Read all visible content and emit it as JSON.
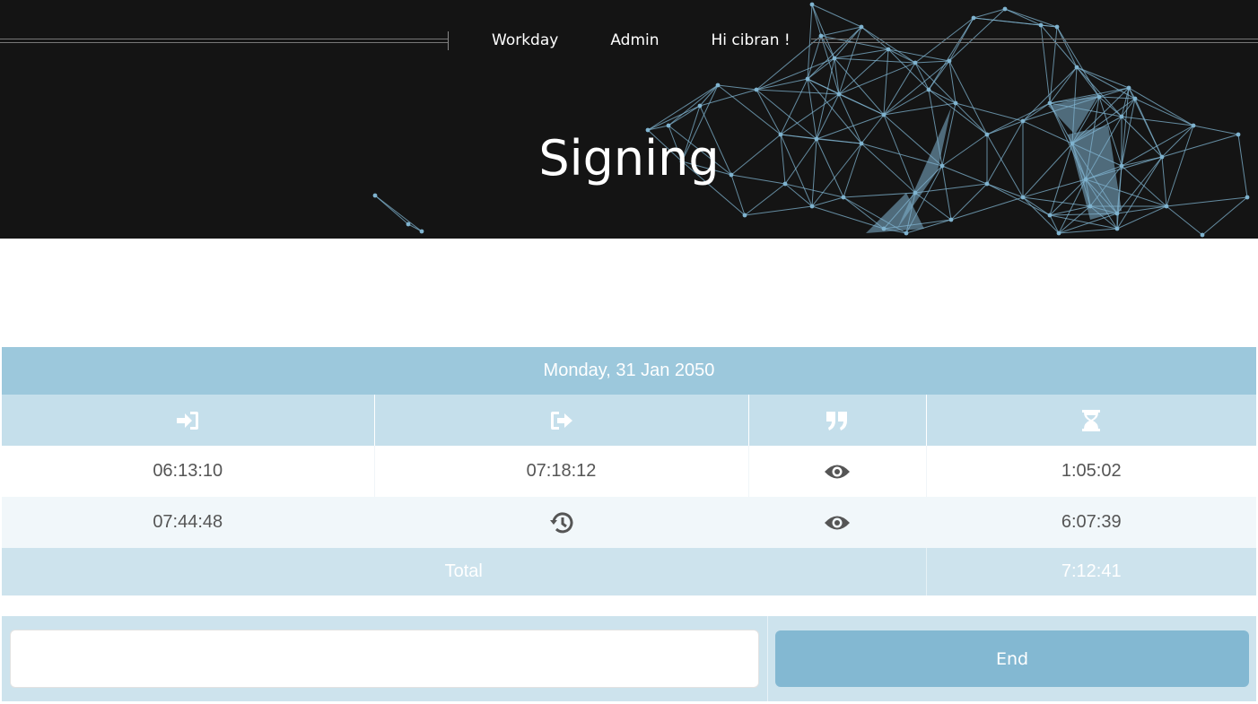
{
  "nav": {
    "items": [
      "Workday",
      "Admin",
      "Hi cibran !"
    ]
  },
  "header": {
    "title": "Signing"
  },
  "table": {
    "date": "Monday, 31 Jan 2050",
    "column_icons": [
      "sign-in-icon",
      "sign-out-icon",
      "quote-icon",
      "hourglass-icon"
    ],
    "rows": [
      {
        "in": "06:13:10",
        "out": "07:18:12",
        "note_icon": "eye-icon",
        "duration": "1:05:02"
      },
      {
        "in": "07:44:48",
        "out_icon": "history-icon",
        "note_icon": "eye-icon",
        "duration": "6:07:39"
      }
    ],
    "total_label": "Total",
    "total_value": "7:12:41"
  },
  "form": {
    "comment_value": "",
    "end_label": "End"
  },
  "colors": {
    "header_bg": "#141414",
    "network_lines": "#7fb3cf",
    "date_bar": "#9cc8dc",
    "icon_bar": "#c5dfeb",
    "total_bar": "#cde3ed",
    "button": "#83b8d2"
  }
}
